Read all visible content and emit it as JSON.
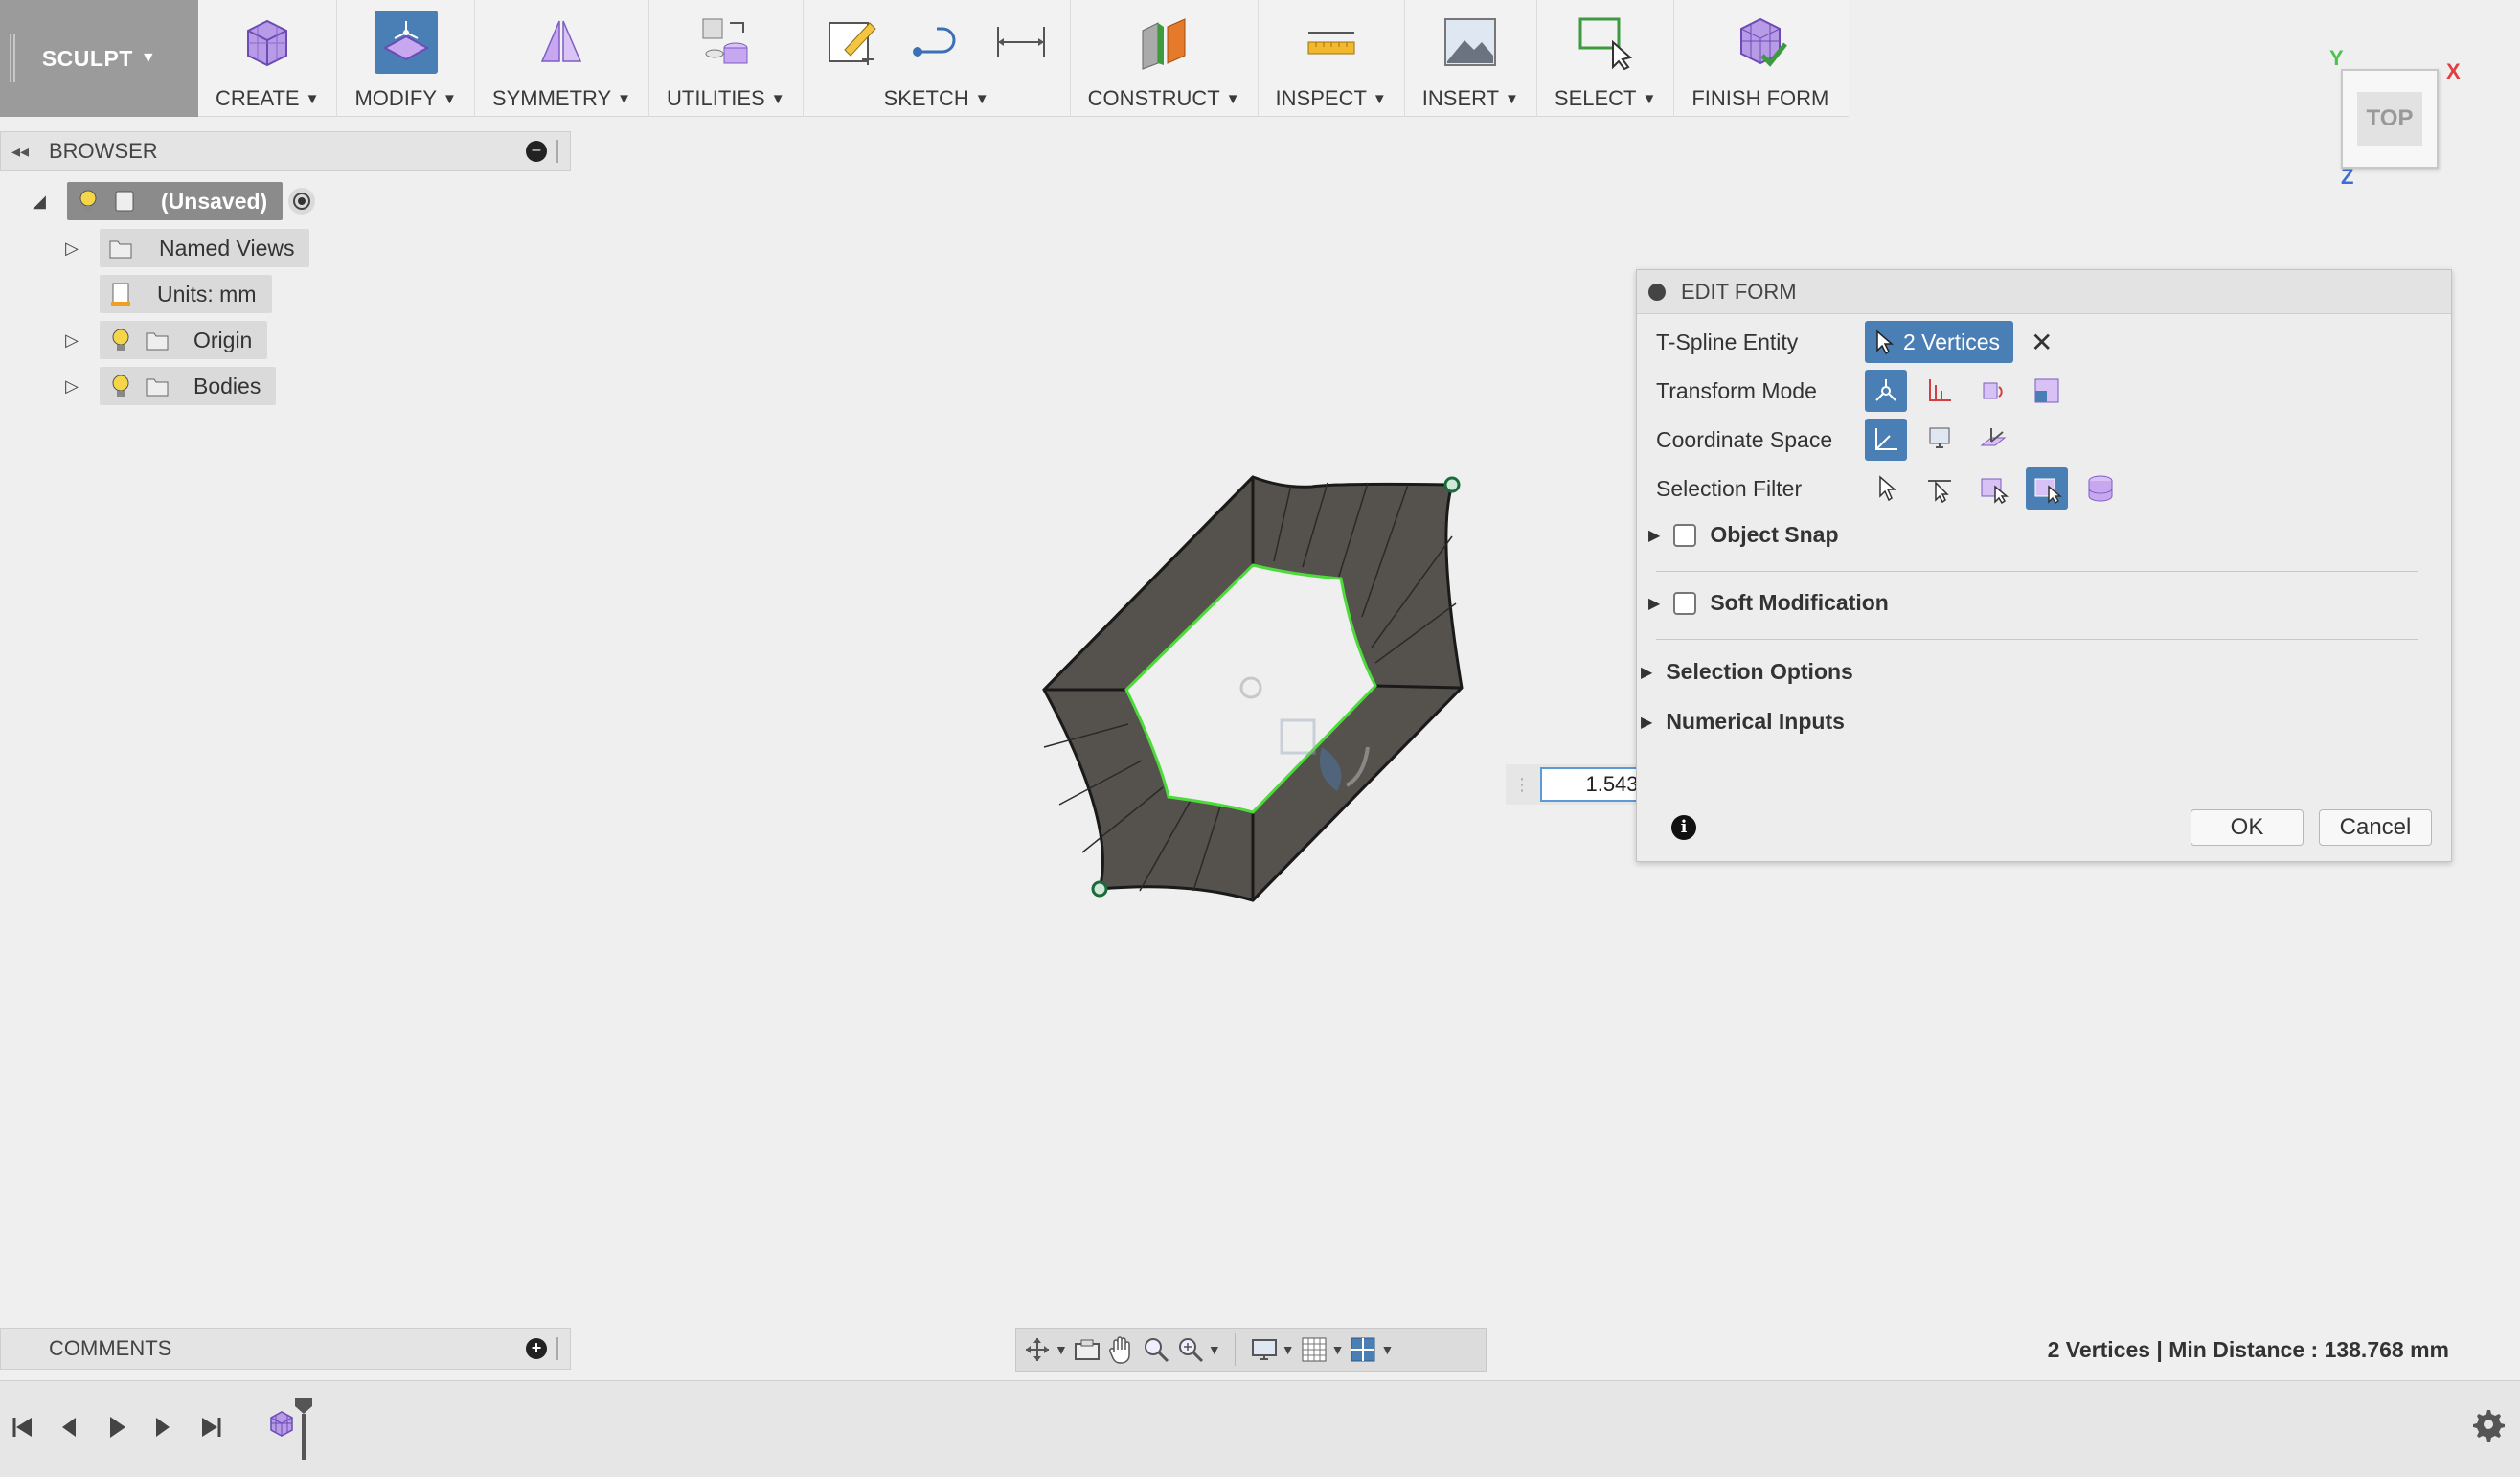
{
  "workspace": {
    "label": "SCULPT"
  },
  "toolbar": {
    "groups": [
      {
        "label": "CREATE"
      },
      {
        "label": "MODIFY"
      },
      {
        "label": "SYMMETRY"
      },
      {
        "label": "UTILITIES"
      },
      {
        "label": "SKETCH"
      },
      {
        "label": "CONSTRUCT"
      },
      {
        "label": "INSPECT"
      },
      {
        "label": "INSERT"
      },
      {
        "label": "SELECT"
      },
      {
        "label": "FINISH FORM"
      }
    ]
  },
  "browser": {
    "title": "BROWSER",
    "root": "(Unsaved)",
    "items": [
      {
        "label": "Named Views"
      },
      {
        "label": "Units: mm"
      },
      {
        "label": "Origin"
      },
      {
        "label": "Bodies"
      }
    ]
  },
  "viewcube": {
    "face": "TOP",
    "x_axis": "X",
    "y_axis": "Y",
    "z_axis": "Z"
  },
  "edit_form": {
    "title": "EDIT FORM",
    "entity_label": "T-Spline Entity",
    "entity_value": "2 Vertices",
    "transform_mode_label": "Transform Mode",
    "coordinate_space_label": "Coordinate Space",
    "selection_filter_label": "Selection Filter",
    "object_snap_label": "Object Snap",
    "soft_modification_label": "Soft Modification",
    "selection_options_label": "Selection Options",
    "numerical_inputs_label": "Numerical Inputs",
    "ok_label": "OK",
    "cancel_label": "Cancel"
  },
  "value_input": {
    "value": "1.543"
  },
  "comments": {
    "title": "COMMENTS"
  },
  "status": {
    "text": "2 Vertices | Min Distance : 138.768 mm"
  },
  "colors": {
    "accent": "#4a7fb5",
    "selection_edge": "#4cdb3a",
    "model": "#55514c"
  }
}
